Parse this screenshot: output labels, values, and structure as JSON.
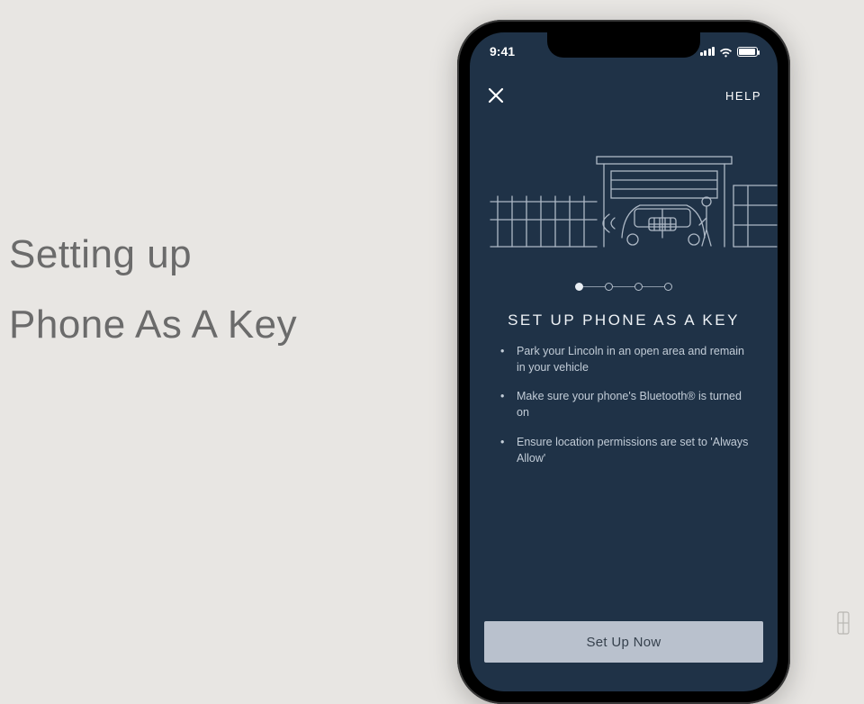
{
  "banner": {
    "line1": "Setting up",
    "line2": "Phone As A Key"
  },
  "statusbar": {
    "time": "9:41"
  },
  "topbar": {
    "help_label": "HELP"
  },
  "screen": {
    "heading": "SET UP PHONE AS A KEY",
    "bullets": [
      "Park your Lincoln in an open area and remain in your vehicle",
      "Make sure your phone's Bluetooth® is turned on",
      "Ensure location permissions are set to 'Always Allow'"
    ],
    "cta_label": "Set Up Now",
    "step_active_index": 0,
    "step_count": 4
  },
  "icons": {
    "close": "close-icon",
    "signal": "cell-signal-icon",
    "wifi": "wifi-icon",
    "battery": "battery-icon",
    "brand": "lincoln-logo-icon",
    "illustration": "garage-car-illustration"
  }
}
